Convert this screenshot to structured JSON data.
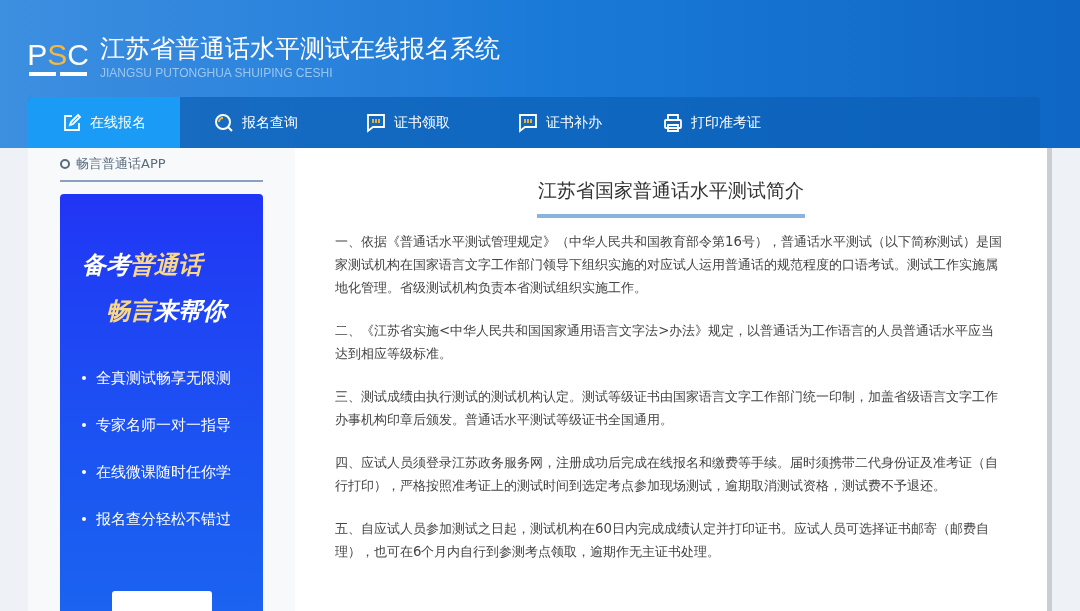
{
  "header": {
    "logo": {
      "letters": [
        "P",
        "S",
        "C"
      ]
    },
    "title": "江苏省普通话水平测试在线报名系统",
    "subtitle": "JIANGSU PUTONGHUA SHUIPING CESHI"
  },
  "nav": [
    {
      "label": "在线报名",
      "kind": "edit",
      "selected": true
    },
    {
      "label": "报名查询",
      "kind": "search",
      "selected": false
    },
    {
      "label": "证书领取",
      "kind": "chat",
      "selected": false
    },
    {
      "label": "证书补办",
      "kind": "chat",
      "selected": false
    },
    {
      "label": "打印准考证",
      "kind": "print",
      "selected": false
    }
  ],
  "sidebar": {
    "heading": "畅言普通话APP",
    "banner": {
      "line_1": [
        {
          "text": "备考",
          "highlight": false
        },
        {
          "text": "普通话",
          "highlight": true
        }
      ],
      "line_2": [
        {
          "text": "畅言",
          "highlight": true
        },
        {
          "text": "来帮你",
          "highlight": false
        }
      ],
      "features": [
        "全真测试畅享无限测",
        "专家名师一对一指导",
        "在线微课随时任你学",
        "报名查分轻松不错过"
      ]
    }
  },
  "article": {
    "title": "江苏省国家普通话水平测试简介",
    "paragraphs": [
      "一、依据《普通话水平测试管理规定》（中华人民共和国教育部令第16号），普通话水平测试（以下简称测试）是国家测试机构在国家语言文字工作部门领导下组织实施的对应试人运用普通话的规范程度的口语考试。测试工作实施属地化管理。省级测试机构负责本省测试组织实施工作。",
      "二、《江苏省实施<中华人民共和国国家通用语言文字法>办法》规定，以普通话为工作语言的人员普通话水平应当达到相应等级标准。",
      "三、测试成绩由执行测试的测试机构认定。测试等级证书由国家语言文字工作部门统一印制，加盖省级语言文字工作办事机构印章后颁发。普通话水平测试等级证书全国通用。",
      "四、应试人员须登录江苏政务服务网，注册成功后完成在线报名和缴费等手续。届时须携带二代身份证及准考证（自行打印），严格按照准考证上的测试时间到选定考点参加现场测试，逾期取消测试资格，测试费不予退还。",
      "五、自应试人员参加测试之日起，测试机构在60日内完成成绩认定并打印证书。应试人员可选择证书邮寄（邮费自理），也可在6个月内自行到参测考点领取，逾期作无主证书处理。"
    ]
  }
}
